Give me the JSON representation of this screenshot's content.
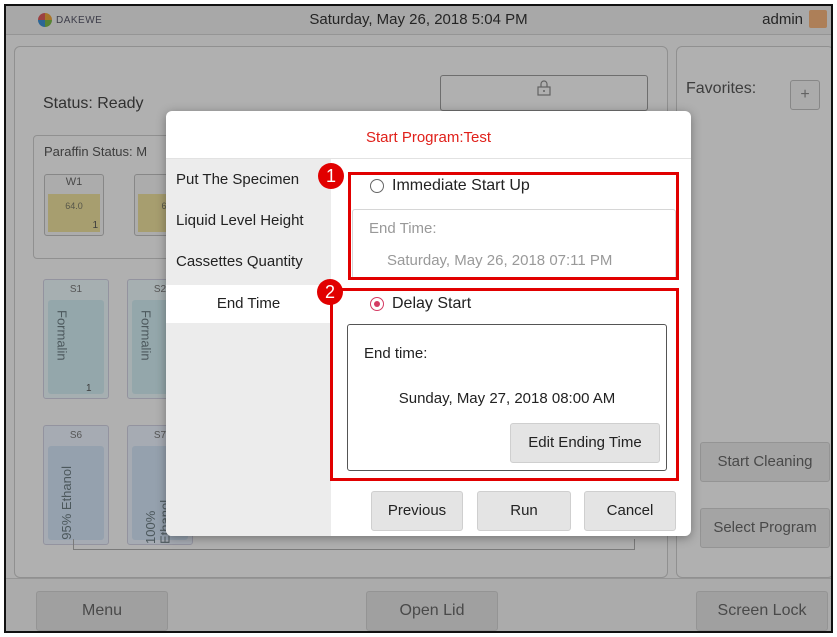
{
  "app": {
    "logo_text": "DAKEWE",
    "datetime": "Saturday, May 26, 2018  5:04 PM",
    "user": "admin"
  },
  "main": {
    "status_label": "Status:  Ready",
    "paraffin_label": "Paraffin Status: M",
    "wax_cups": [
      {
        "name": "W1",
        "value": "64.0",
        "count": "1"
      },
      {
        "name": "",
        "value": "6",
        "count": ""
      }
    ],
    "stations_row1": [
      {
        "name": "S1",
        "reagent": "Formalin",
        "count": "1"
      },
      {
        "name": "S2",
        "reagent": "Formalin",
        "count": ""
      }
    ],
    "stations_row2": [
      {
        "name": "S6",
        "reagent": "95% Ethanol",
        "count": ""
      },
      {
        "name": "S7",
        "reagent": "100% Ethanol",
        "count": ""
      }
    ]
  },
  "right_panel": {
    "favorites_label": "Favorites:",
    "add_label": "+",
    "start_cleaning": "Start Cleaning",
    "select_program": "Select Program"
  },
  "bottom_bar": {
    "menu": "Menu",
    "open_lid": "Open Lid",
    "screen_lock": "Screen Lock"
  },
  "dialog": {
    "title": "Start Program:Test",
    "nav": [
      "Put The Specimen",
      "Liquid Level Height",
      "Cassettes Quantity",
      "End Time"
    ],
    "immediate": {
      "label": "Immediate Start Up",
      "end_label": "End Time:",
      "end_value": "Saturday, May 26, 2018 07:11 PM",
      "selected": false
    },
    "delay": {
      "label": "Delay Start",
      "end_label": "End time:",
      "end_value": "Sunday, May 27, 2018 08:00 AM",
      "edit_button": "Edit Ending Time",
      "selected": true
    },
    "buttons": {
      "previous": "Previous",
      "run": "Run",
      "cancel": "Cancel"
    }
  },
  "annotations": {
    "marker1": "1",
    "marker2": "2",
    "color": "#e10000"
  },
  "colors": {
    "title_red": "#e0201a",
    "radio_selected": "#d43b63"
  }
}
